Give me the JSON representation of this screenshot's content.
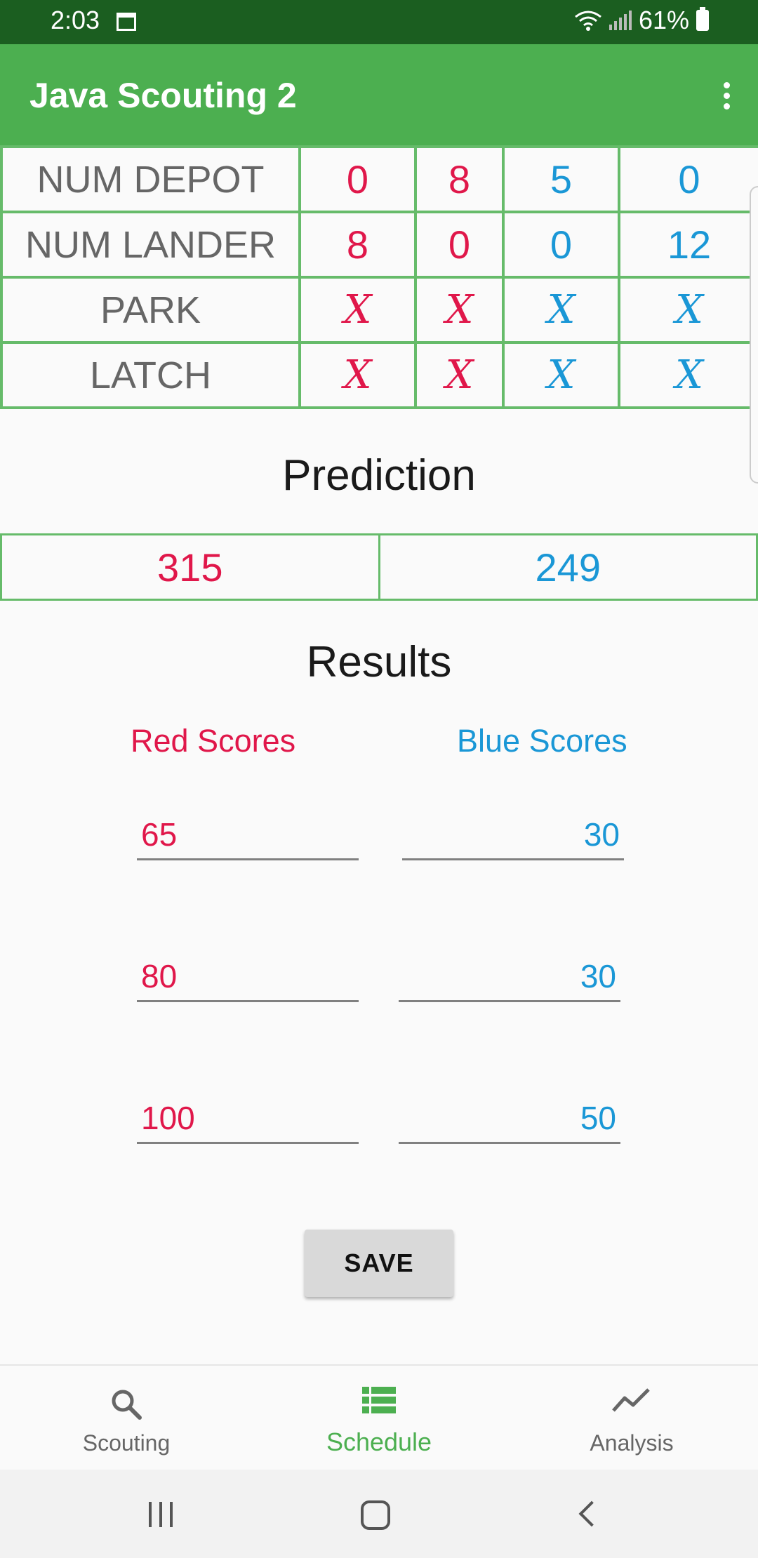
{
  "status_bar": {
    "time": "2:03",
    "battery": "61%"
  },
  "app_bar": {
    "title": "Java Scouting 2"
  },
  "stats_table": {
    "rows": [
      {
        "label": "NUM DEPOT",
        "values": [
          "0",
          "8",
          "5",
          "0"
        ]
      },
      {
        "label": "NUM LANDER",
        "values": [
          "8",
          "0",
          "0",
          "12"
        ]
      },
      {
        "label": "PARK",
        "values": [
          "X",
          "X",
          "X",
          "X"
        ]
      },
      {
        "label": "LATCH",
        "values": [
          "X",
          "X",
          "X",
          "X"
        ]
      }
    ]
  },
  "prediction": {
    "title": "Prediction",
    "red": "315",
    "blue": "249"
  },
  "results": {
    "title": "Results",
    "red_header": "Red Scores",
    "blue_header": "Blue Scores",
    "red_scores": [
      "65",
      "80",
      "100"
    ],
    "blue_scores": [
      "30",
      "30",
      "50"
    ]
  },
  "save_button": "SAVE",
  "bottom_nav": [
    {
      "label": "Scouting",
      "icon": "search-icon"
    },
    {
      "label": "Schedule",
      "icon": "list-icon",
      "active": true
    },
    {
      "label": "Analysis",
      "icon": "trending-icon"
    }
  ],
  "colors": {
    "red": "#e0174a",
    "blue": "#1a97d6",
    "green": "#4caf50",
    "dark_green": "#1b5e20"
  }
}
